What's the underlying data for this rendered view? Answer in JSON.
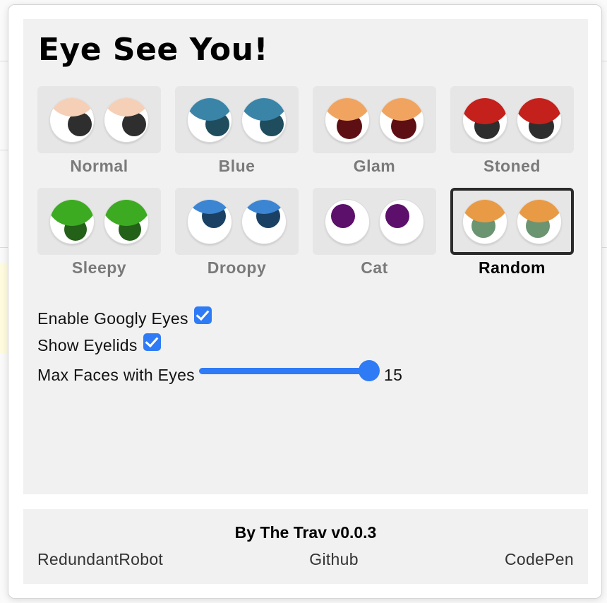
{
  "title": "Eye See You!",
  "eye_options": [
    {
      "label": "Normal",
      "lid_color": "#f5cfb6",
      "pupil_color": "#2e2e2e",
      "lid": "small",
      "pupil": "center-right",
      "selected": false
    },
    {
      "label": "Blue",
      "lid_color": "#3a84a8",
      "pupil_color": "#1f4d5e",
      "lid": "medium",
      "pupil": "center-right",
      "selected": false
    },
    {
      "label": "Glam",
      "lid_color": "#f0a45f",
      "pupil_color": "#5e0f13",
      "lid": "medium",
      "pupil": "center",
      "selected": false
    },
    {
      "label": "Stoned",
      "lid_color": "#c4201c",
      "pupil_color": "#2e2e2e",
      "lid": "half",
      "pupil": "center",
      "selected": false
    },
    {
      "label": "Sleepy",
      "lid_color": "#3cab22",
      "pupil_color": "#236118",
      "lid": "half",
      "pupil": "low",
      "selected": false
    },
    {
      "label": "Droopy",
      "lid_color": "#3c85d2",
      "pupil_color": "#1a4163",
      "lid": "thin",
      "pupil": "high",
      "selected": false
    },
    {
      "label": "Cat",
      "lid_color": "none",
      "pupil_color": "#5c0f6b",
      "lid": "none",
      "pupil": "high-left",
      "selected": false
    },
    {
      "label": "Random",
      "lid_color": "#e89a45",
      "pupil_color": "#6b9470",
      "lid": "medium",
      "pupil": "center-left",
      "selected": true
    }
  ],
  "settings": {
    "googly_label": "Enable Googly Eyes",
    "googly_checked": true,
    "eyelids_label": "Show Eyelids",
    "eyelids_checked": true,
    "max_faces_label": "Max Faces with Eyes",
    "max_faces_value": "15",
    "max_faces_fraction": 1.0
  },
  "footer": {
    "title": "By The Trav v0.0.3",
    "links": [
      "RedundantRobot",
      "Github",
      "CodePen"
    ]
  }
}
